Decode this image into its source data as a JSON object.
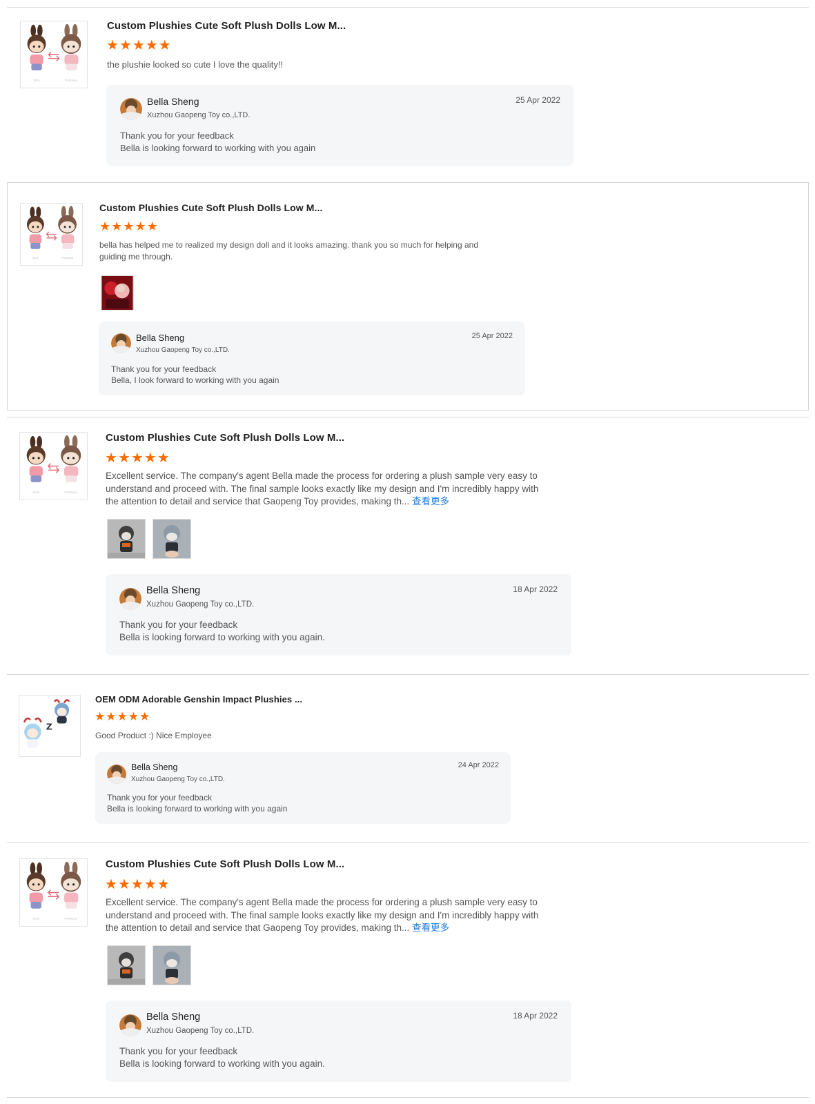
{
  "colors": {
    "star": "#ff6a00",
    "link": "#1e7ddc",
    "reply_bg": "#f5f6f8",
    "divider": "#d7d7d7"
  },
  "icons": {
    "star": "star-icon",
    "avatar": "seller-avatar",
    "thumb": "product-thumbnail"
  },
  "reviews": [
    {
      "product_title": "Custom Plushies Cute Soft Plush Dolls Low M...",
      "rating": 5,
      "text": "the plushie looked so cute I love the quality!!",
      "see_more": "",
      "reply": {
        "name": "Bella Sheng",
        "company": "Xuzhou Gaopeng Toy co.,LTD.",
        "date": "25 Apr 2022",
        "line1": "Thank you for your feedback",
        "line2": "Bella is looking forward to working with you again"
      }
    },
    {
      "product_title": "Custom Plushies Cute Soft Plush Dolls Low M...",
      "rating": 5,
      "text": "bella has helped me to realized my design doll and it looks amazing. thank you so much for helping and guiding me through.",
      "see_more": "",
      "reply": {
        "name": "Bella Sheng",
        "company": "Xuzhou Gaopeng Toy co.,LTD.",
        "date": "25 Apr 2022",
        "line1": "Thank you for your feedback",
        "line2": "Bella, I look forward to working with you again"
      }
    },
    {
      "product_title": "Custom Plushies Cute Soft Plush Dolls Low M...",
      "rating": 5,
      "text": "Excellent service. The company's agent Bella made the process for ordering a plush sample very easy to understand and proceed with. The final sample looks exactly like my design and I'm incredibly happy with the attention to detail and service that Gaopeng Toy provides, making th...",
      "see_more": "查看更多",
      "reply": {
        "name": "Bella Sheng",
        "company": "Xuzhou Gaopeng Toy co.,LTD.",
        "date": "18 Apr 2022",
        "line1": "Thank you for your feedback",
        "line2": "Bella is looking forward to working with you again."
      }
    },
    {
      "product_title": "OEM ODM Adorable Genshin Impact Plushies ...",
      "rating": 5,
      "text": "Good Product :) Nice Employee",
      "see_more": "",
      "reply": {
        "name": "Bella Sheng",
        "company": "Xuzhou Gaopeng Toy co.,LTD.",
        "date": "24 Apr 2022",
        "line1": "Thank you for your feedback",
        "line2": "Bella is looking forward to working with you again"
      }
    },
    {
      "product_title": "Custom Plushies Cute Soft Plush Dolls Low M...",
      "rating": 5,
      "text": "Excellent service. The company's agent Bella made the process for ordering a plush sample very easy to understand and proceed with. The final sample looks exactly like my design and I'm incredibly happy with the attention to detail and service that Gaopeng Toy provides, making th...",
      "see_more": "查看更多",
      "reply": {
        "name": "Bella Sheng",
        "company": "Xuzhou Gaopeng Toy co.,LTD.",
        "date": "18 Apr 2022",
        "line1": "Thank you for your feedback",
        "line2": "Bella is looking forward to working with you again."
      }
    }
  ]
}
